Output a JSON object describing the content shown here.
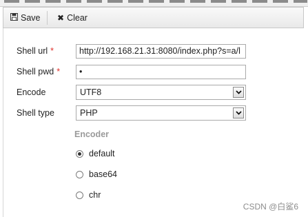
{
  "toolbar": {
    "save_label": "Save",
    "clear_label": "Clear"
  },
  "form": {
    "shell_url": {
      "label": "Shell url",
      "required_mark": "*",
      "value": "http://192.168.21.31:8080/index.php?s=a/l"
    },
    "shell_pwd": {
      "label": "Shell pwd",
      "required_mark": "*",
      "value": "•"
    },
    "encode": {
      "label": "Encode",
      "selected": "UTF8"
    },
    "shell_type": {
      "label": "Shell type",
      "selected": "PHP"
    },
    "encoder": {
      "title": "Encoder",
      "options": [
        {
          "label": "default",
          "checked": true
        },
        {
          "label": "base64",
          "checked": false
        },
        {
          "label": "chr",
          "checked": false
        }
      ]
    }
  },
  "watermark": "CSDN @白鲨6"
}
